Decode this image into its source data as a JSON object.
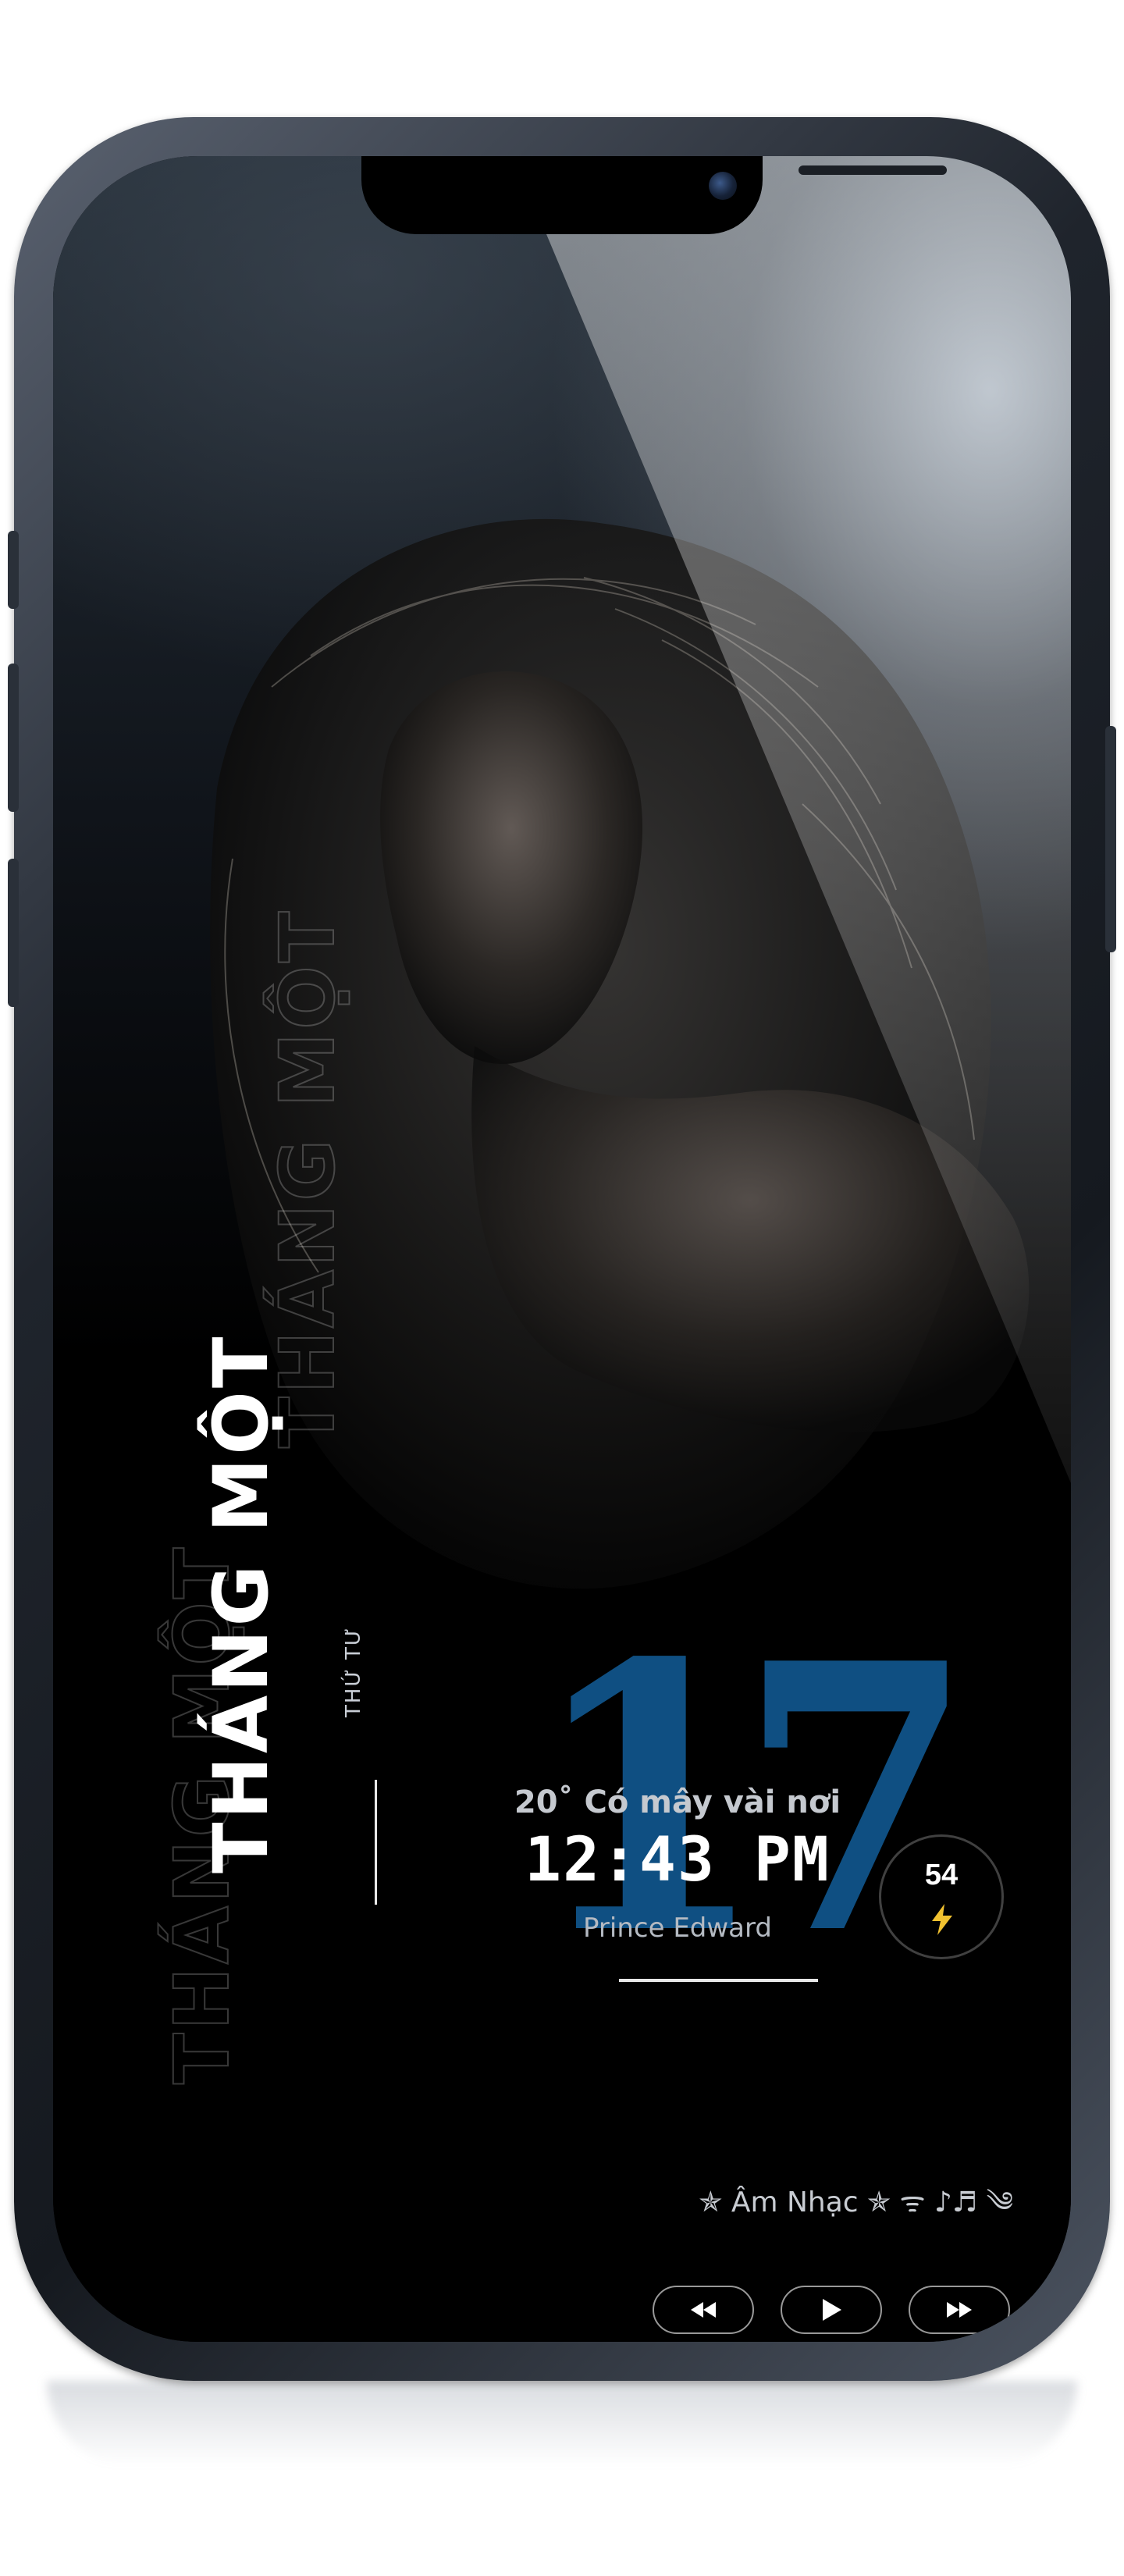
{
  "lockscreen": {
    "month": "THÁNG MỘT",
    "weekday": "THỨ TƯ",
    "day": "17",
    "weather": "20˚ Có mây vài nơi",
    "time": "12:43 PM",
    "location": "Prince Edward",
    "battery_level": "54",
    "music_label": "✯ Âm Nhạc ✯ ᯤ ♪♬ ༄"
  },
  "controls": {
    "previous_icon": "rewind-icon",
    "play_icon": "play-icon",
    "next_icon": "fast-forward-icon"
  },
  "colors": {
    "accent_date": "#0f4f82",
    "battery_bolt": "#f2c230",
    "text_primary": "#ffffff"
  }
}
